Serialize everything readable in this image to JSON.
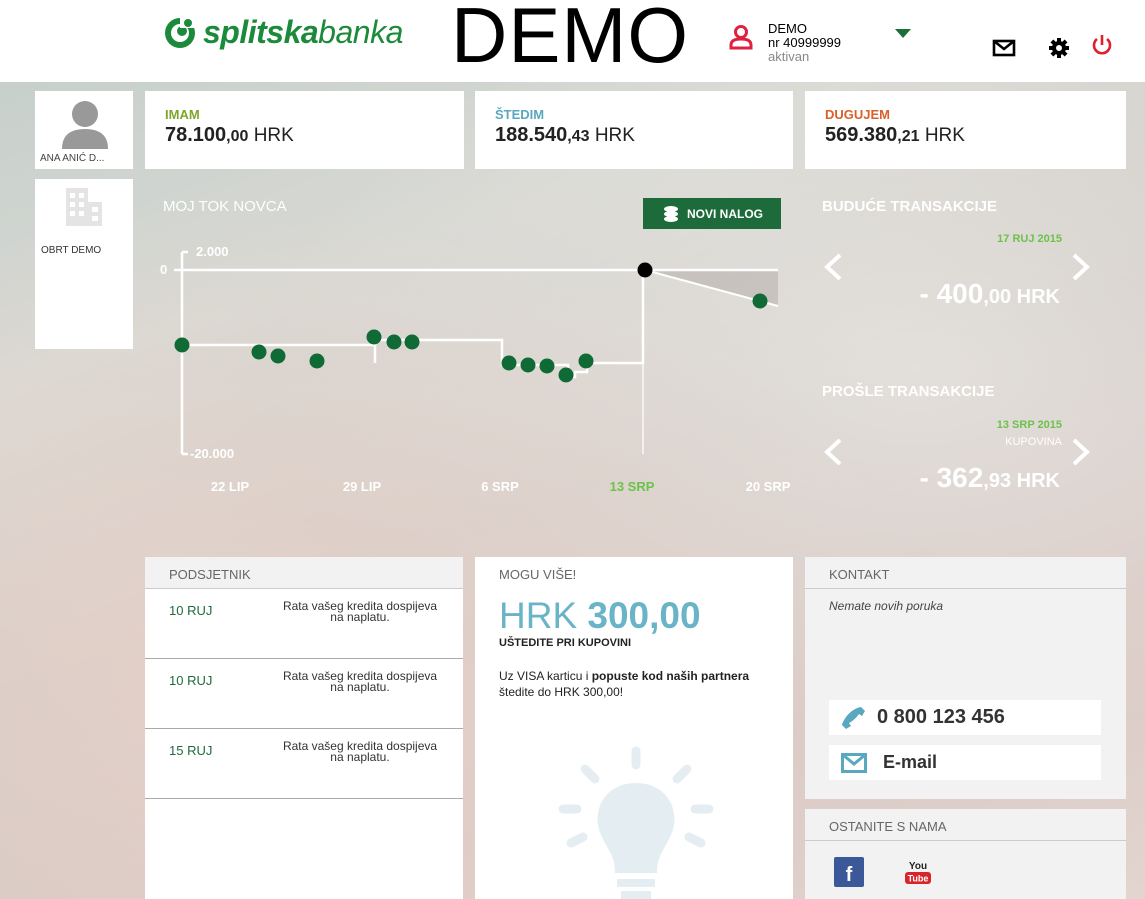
{
  "header": {
    "logo_bold": "splitska",
    "logo_light": "banka",
    "demo_label": "DEMO",
    "user_name": "DEMO",
    "user_nr": "nr 40999999",
    "user_status": "aktivan",
    "icons": [
      "mail-icon",
      "gear-icon",
      "power-icon"
    ]
  },
  "profile": {
    "name": "ANA ANIĆ D..."
  },
  "company": {
    "name": "OBRT DEMO"
  },
  "balances": [
    {
      "label": "IMAM",
      "int": "78.100",
      "dec": ",00",
      "cur": " HRK",
      "color": "#7fa62b"
    },
    {
      "label": "ŠTEDIM",
      "int": "188.540",
      "dec": ",43",
      "cur": " HRK",
      "color": "#5aa8bf"
    },
    {
      "label": "DUGUJEM",
      "int": "569.380",
      "dec": ",21",
      "cur": " HRK",
      "color": "#d9602a"
    }
  ],
  "cashflow": {
    "title": "MOJ TOK NOVCA",
    "button": "NOVI NALOG"
  },
  "chart_data": {
    "type": "scatter",
    "y_ticks": [
      "2.000",
      "0",
      "-20.000"
    ],
    "x_ticks": [
      "22 LIP",
      "29 LIP",
      "6 SRP",
      "13 SRP",
      "20 SRP"
    ],
    "highlight_tick": "13 SRP",
    "highlight_color": "#6cc24a",
    "series_color": "#0f6a36"
  },
  "future_tx": {
    "title": "BUDUĆE TRANSAKCIJE",
    "date": "17 RUJ 2015",
    "amount_int": "- 400",
    "amount_dec": ",00",
    "cur": " HRK"
  },
  "past_tx": {
    "title": "PROŠLE TRANSAKCIJE",
    "date": "13 SRP 2015",
    "type": "KUPOVINA",
    "amount_int": "- 362",
    "amount_dec": ",93",
    "cur": " HRK"
  },
  "reminder": {
    "title": "PODSJETNIK",
    "items": [
      {
        "date": "10 RUJ",
        "text": "Rata vašeg kredita dospijeva na naplatu."
      },
      {
        "date": "10 RUJ",
        "text": "Rata vašeg kredita dospijeva na naplatu."
      },
      {
        "date": "15 RUJ",
        "text": "Rata vašeg kredita dospijeva na naplatu."
      }
    ]
  },
  "promo": {
    "title": "MOGU VIŠE!",
    "amount_cur": "HRK ",
    "amount": "300,00",
    "subtitle": "UŠTEDITE PRI KUPOVINI",
    "desc_1": "Uz VISA karticu i ",
    "desc_bold": "popuste kod naših partnera",
    "desc_2": " štedite do HRK 300,00!"
  },
  "contact": {
    "title": "KONTAKT",
    "message": "Nemate novih poruka",
    "phone": "0 800 123 456",
    "email": "E-mail"
  },
  "social": {
    "title": "OSTANITE S NAMA",
    "facebook_letter": "f",
    "youtube_top": "You",
    "youtube_bottom": "Tube"
  }
}
